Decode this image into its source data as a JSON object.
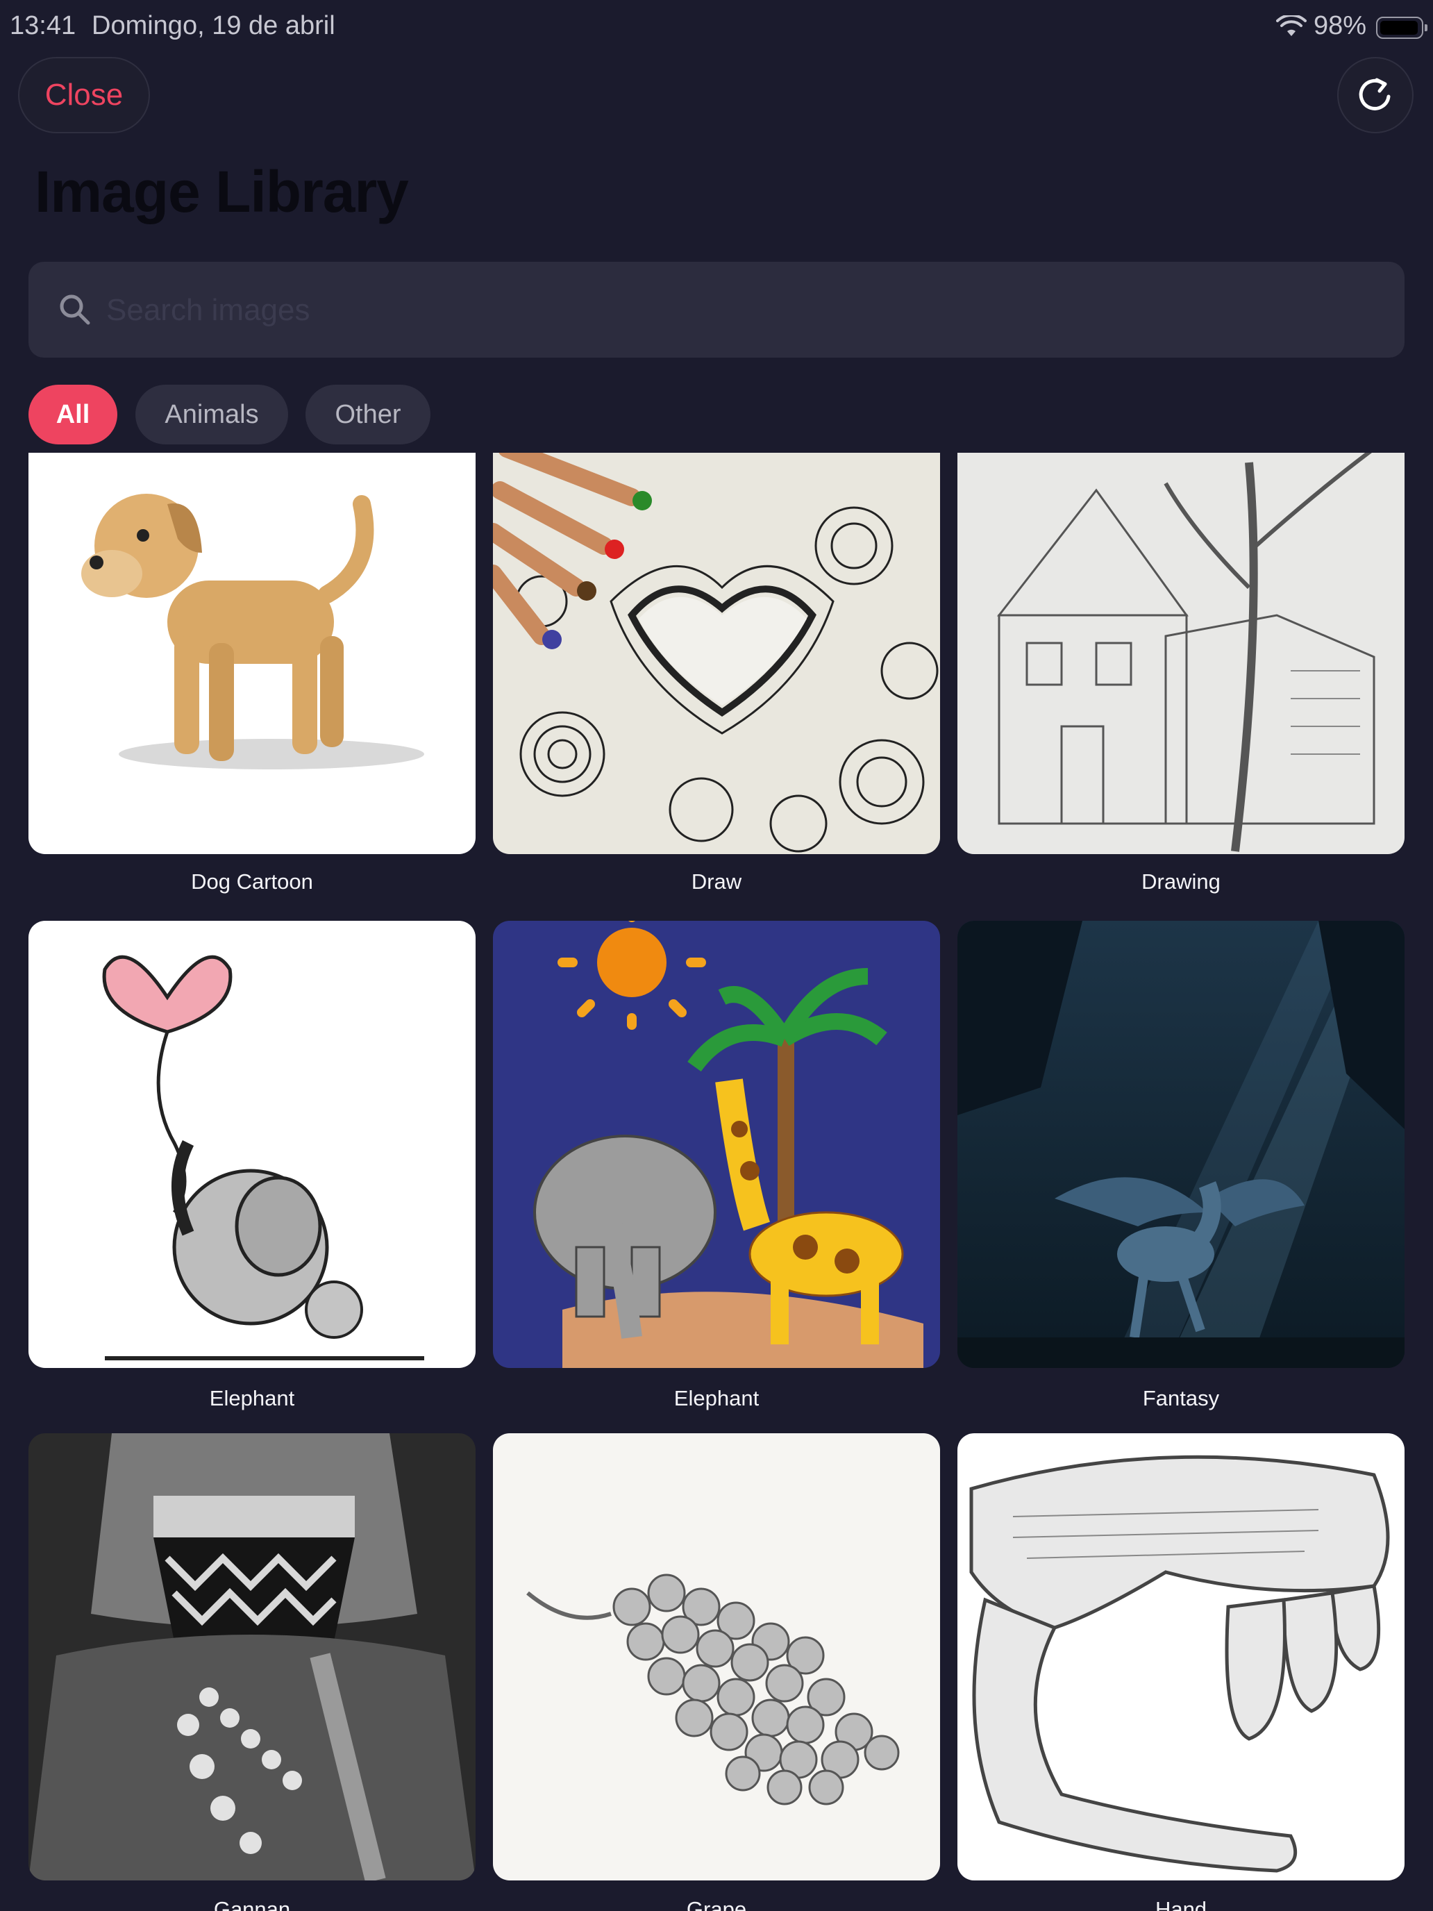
{
  "status_bar": {
    "time": "13:41",
    "date": "Domingo, 19 de abril",
    "battery": "98%",
    "wifi_icon": "wifi-icon",
    "battery_icon": "battery-icon"
  },
  "header": {
    "close_label": "Close",
    "refresh_icon": "refresh-icon",
    "title": "Image Library"
  },
  "search": {
    "placeholder": "Search images",
    "value": "",
    "icon": "search-icon"
  },
  "filters": [
    {
      "label": "All",
      "selected": true
    },
    {
      "label": "Animals",
      "selected": false
    },
    {
      "label": "Other",
      "selected": false
    }
  ],
  "images": [
    {
      "caption": "Dog Cartoon"
    },
    {
      "caption": "Draw"
    },
    {
      "caption": "Drawing"
    },
    {
      "caption": "Elephant"
    },
    {
      "caption": "Elephant"
    },
    {
      "caption": "Fantasy"
    },
    {
      "caption": "Gannan"
    },
    {
      "caption": "Grape"
    },
    {
      "caption": "Hand"
    }
  ],
  "colors": {
    "background": "#1b1b2d",
    "accent": "#ee4460",
    "chip": "#2e2e40",
    "search_field": "#2c2c3e"
  }
}
